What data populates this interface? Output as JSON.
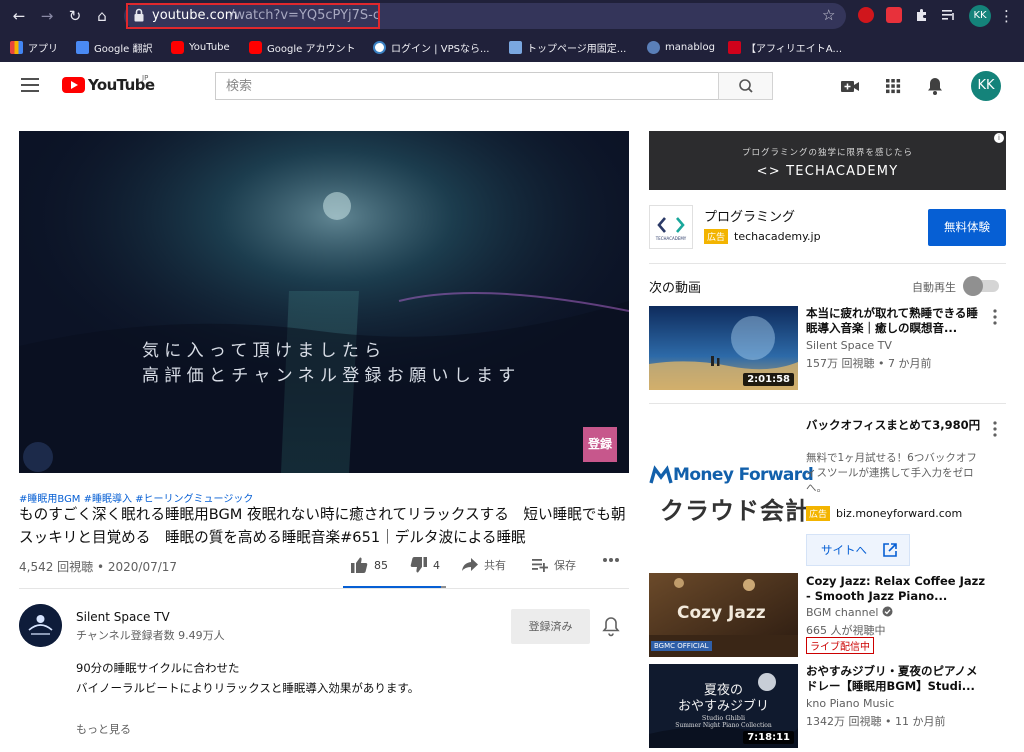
{
  "browser": {
    "url_host": "youtube.com",
    "url_path": "/watch?v=YQ5cPYj7S-c",
    "profile_initials": "KK",
    "bookmarks": [
      {
        "label": "アプリ",
        "color": "#e8453c"
      },
      {
        "label": "Google 翻訳",
        "color": "#4a8af4"
      },
      {
        "label": "YouTube",
        "color": "#ff0000"
      },
      {
        "label": "Google アカウント",
        "color": "#ff0000"
      },
      {
        "label": "ログイン | VPSなら...",
        "color": "#3b82c4"
      },
      {
        "label": "トップページ用固定...",
        "color": "#7aa7e0"
      },
      {
        "label": "manablog",
        "color": "#5a7fb8"
      },
      {
        "label": "【アフィリエイトA...",
        "color": "#d0021b"
      }
    ]
  },
  "youtube": {
    "logo_text": "YouTube",
    "logo_region": "JP",
    "search_placeholder": "検索",
    "avatar_initials": "KK"
  },
  "video": {
    "caption_line1": "気に入って頂けましたら",
    "caption_line2": "高評価とチャンネル登録お願いします",
    "subscribe_watermark": "登録",
    "hashtags": "#睡眠用BGM #睡眠導入 #ヒーリングミュージック",
    "title": "ものすごく深く眠れる睡眠用BGM 夜眠れない時に癒されてリラックスする　短い睡眠でも朝スッキリと目覚める　睡眠の質を高める睡眠音楽#651｜デルタ波による睡眠",
    "view_line": "4,542 回視聴 • 2020/07/17",
    "likes": "85",
    "dislikes": "4",
    "like_ratio": 0.955,
    "share_label": "共有",
    "save_label": "保存"
  },
  "owner": {
    "name": "Silent Space TV",
    "subscribers": "チャンネル登録者数 9.49万人",
    "subscribed_label": "登録済み",
    "description_line1": "90分の睡眠サイクルに合わせた",
    "description_line2": "バイノーラルビートによりリラックスと睡眠導入効果があります。",
    "show_more": "もっと見る"
  },
  "sidebar": {
    "ad_banner_tagline": "プログラミングの独学に限界を感じたら",
    "ad_banner_brand": "<> TECHACADEMY",
    "ad_info_glyph": "i",
    "ad_logo_text": "TECHACADEMY",
    "ad_title": "プログラミング",
    "ad_badge": "広告",
    "ad_domain": "techacademy.jp",
    "ad_cta": "無料体験",
    "up_next": "次の動画",
    "autoplay_label": "自動再生",
    "recommendations": [
      {
        "title": "本当に疲れが取れて熟睡できる睡眠導入音楽｜癒しの瞑想音...",
        "channel": "Silent Space TV",
        "meta": "157万 回視聴 • 7 か月前",
        "duration": "2:01:58"
      },
      {
        "title": "Cozy Jazz: Relax Coffee Jazz - Smooth Jazz Piano...",
        "channel": "BGM channel",
        "meta": "665 人が視聴中",
        "live_badge": "ライブ配信中",
        "thumb_text": "Cozy Jazz",
        "thumb_badge": "BGMC OFFICIAL"
      },
      {
        "title": "おやすみジブリ・夏夜のピアノメドレー【睡眠用BGM】Studi...",
        "channel": "kno Piano Music",
        "meta": "1342万 回視聴 • 11 か月前",
        "duration": "7:18:11",
        "thumb_line1": "夏夜の",
        "thumb_line2": "おやすみジブリ",
        "thumb_line3": "Studio Ghibli",
        "thumb_line4": "Summer Night Piano Collection"
      }
    ],
    "mf_ad": {
      "brand": "Money Forward",
      "product": "クラウド会計",
      "title": "バックオフィスまとめて3,980円",
      "description": "無料で1ヶ月試せる！6つバックオフィスツールが連携して手入力をゼロへ。",
      "badge": "広告",
      "domain": "biz.moneyforward.com",
      "cta": "サイトへ"
    }
  }
}
